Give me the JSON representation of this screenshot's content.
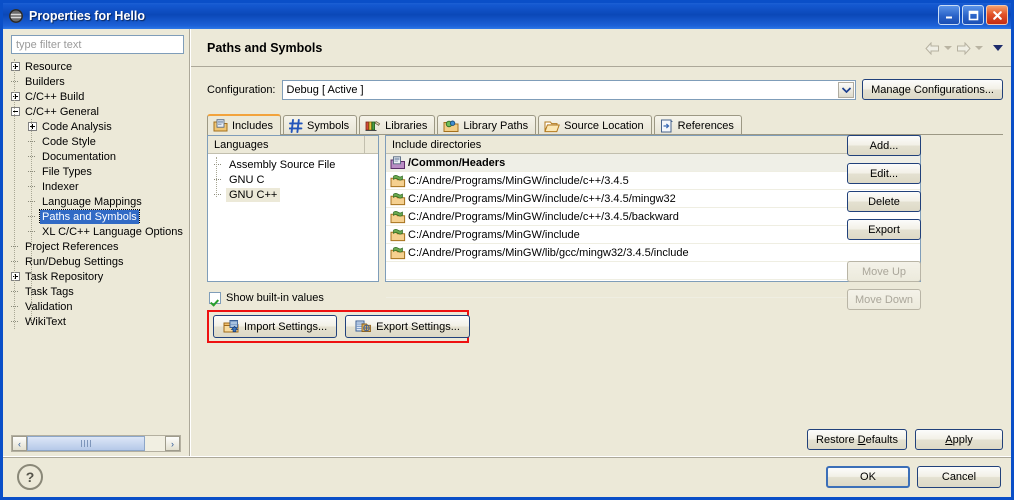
{
  "window": {
    "title": "Properties for Hello",
    "icon": "eclipse-properties-icon",
    "minimize_label": "Minimize",
    "maximize_label": "Maximize",
    "close_label": "Close"
  },
  "sidebar": {
    "filter_placeholder": "type filter text",
    "filter_value": "",
    "items": [
      {
        "label": "Resource",
        "indent": 0,
        "toggle": "plus",
        "selected": false
      },
      {
        "label": "Builders",
        "indent": 0,
        "toggle": "leaf",
        "selected": false
      },
      {
        "label": "C/C++ Build",
        "indent": 0,
        "toggle": "plus",
        "selected": false
      },
      {
        "label": "C/C++ General",
        "indent": 0,
        "toggle": "minus",
        "selected": false
      },
      {
        "label": "Code Analysis",
        "indent": 1,
        "toggle": "plus",
        "selected": false
      },
      {
        "label": "Code Style",
        "indent": 1,
        "toggle": "leaf",
        "selected": false
      },
      {
        "label": "Documentation",
        "indent": 1,
        "toggle": "leaf",
        "selected": false
      },
      {
        "label": "File Types",
        "indent": 1,
        "toggle": "leaf",
        "selected": false
      },
      {
        "label": "Indexer",
        "indent": 1,
        "toggle": "leaf",
        "selected": false
      },
      {
        "label": "Language Mappings",
        "indent": 1,
        "toggle": "leaf",
        "selected": false
      },
      {
        "label": "Paths and Symbols",
        "indent": 1,
        "toggle": "leaf",
        "selected": true
      },
      {
        "label": "XL C/C++ Language Options",
        "indent": 1,
        "toggle": "leaf",
        "selected": false
      },
      {
        "label": "Project References",
        "indent": 0,
        "toggle": "leaf",
        "selected": false
      },
      {
        "label": "Run/Debug Settings",
        "indent": 0,
        "toggle": "leaf",
        "selected": false
      },
      {
        "label": "Task Repository",
        "indent": 0,
        "toggle": "plus",
        "selected": false
      },
      {
        "label": "Task Tags",
        "indent": 0,
        "toggle": "leaf",
        "selected": false
      },
      {
        "label": "Validation",
        "indent": 0,
        "toggle": "leaf",
        "selected": false
      },
      {
        "label": "WikiText",
        "indent": 0,
        "toggle": "leaf",
        "selected": false
      }
    ],
    "scroll_left_label": "‹",
    "scroll_right_label": "›"
  },
  "page": {
    "title": "Paths and Symbols",
    "back_label": "Back",
    "forward_label": "Forward",
    "menu_label": "View Menu"
  },
  "configuration": {
    "label": "Configuration:",
    "value": "Debug  [ Active ]",
    "manage_label": "Manage Configurations..."
  },
  "tabs": [
    {
      "label": "Includes",
      "icon": "includes-icon",
      "active": true
    },
    {
      "label": "Symbols",
      "icon": "hash-icon",
      "active": false
    },
    {
      "label": "Libraries",
      "icon": "books-icon",
      "active": false
    },
    {
      "label": "Library Paths",
      "icon": "library-folder-icon",
      "active": false
    },
    {
      "label": "Source Location",
      "icon": "open-folder-icon",
      "active": false
    },
    {
      "label": "References",
      "icon": "reference-icon",
      "active": false
    }
  ],
  "languages": {
    "header": "Languages",
    "items": [
      {
        "label": "Assembly Source File",
        "selected": false
      },
      {
        "label": "GNU C",
        "selected": false
      },
      {
        "label": "GNU C++",
        "selected": true
      }
    ]
  },
  "includes": {
    "header": "Include directories",
    "rows": [
      {
        "path": "/Common/Headers",
        "builtin": true,
        "icon": "workspace-folder-icon"
      },
      {
        "path": "C:/Andre/Programs/MinGW/include/c++/3.4.5",
        "builtin": false,
        "icon": "include-folder-icon"
      },
      {
        "path": "C:/Andre/Programs/MinGW/include/c++/3.4.5/mingw32",
        "builtin": false,
        "icon": "include-folder-icon"
      },
      {
        "path": "C:/Andre/Programs/MinGW/include/c++/3.4.5/backward",
        "builtin": false,
        "icon": "include-folder-icon"
      },
      {
        "path": "C:/Andre/Programs/MinGW/include",
        "builtin": false,
        "icon": "include-folder-icon"
      },
      {
        "path": "C:/Andre/Programs/MinGW/lib/gcc/mingw32/3.4.5/include",
        "builtin": false,
        "icon": "include-folder-icon"
      }
    ]
  },
  "side_buttons": [
    {
      "label": "Add...",
      "enabled": true
    },
    {
      "label": "Edit...",
      "enabled": true
    },
    {
      "label": "Delete",
      "enabled": true
    },
    {
      "label": "Export",
      "enabled": true
    },
    {
      "label": "Move Up",
      "enabled": false
    },
    {
      "label": "Move Down",
      "enabled": false
    }
  ],
  "options": {
    "show_builtin_label": "Show built-in values",
    "show_builtin_checked": true
  },
  "settings_buttons": {
    "highlight_color": "#ee1111",
    "import_label": "Import Settings...",
    "export_label": "Export Settings..."
  },
  "footer": {
    "restore_defaults_label": "Restore Defaults",
    "restore_defaults_mnemonic": "D",
    "apply_label": "Apply",
    "apply_mnemonic": "A",
    "ok_label": "OK",
    "cancel_label": "Cancel",
    "help_label": "?"
  }
}
